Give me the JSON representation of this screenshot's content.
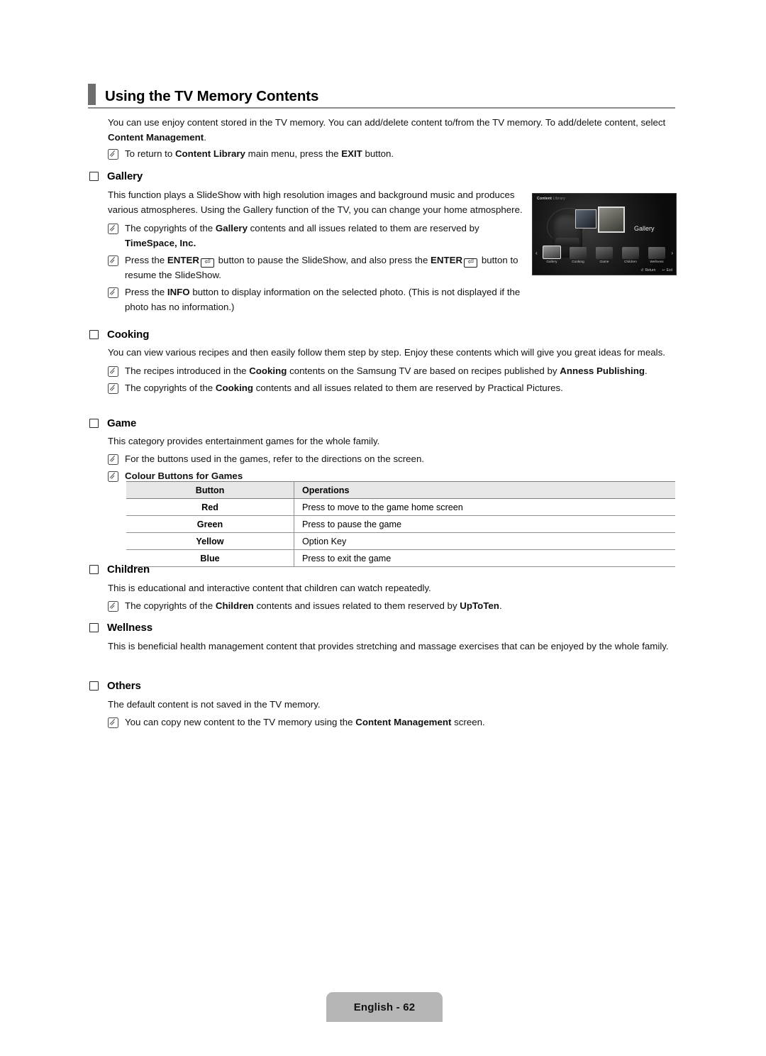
{
  "page": {
    "title": "Using the TV Memory Contents",
    "footer_label": "English - 62"
  },
  "intro": {
    "line1_a": "You can use enjoy content stored in the TV memory. You can add/delete content to/from the TV memory. To add/delete content, select ",
    "line1_b": "Content Management",
    "line1_c": ".",
    "note_a": "To return to ",
    "note_b": "Content Library",
    "note_c": " main menu, press the ",
    "note_d": "EXIT",
    "note_e": " button."
  },
  "gallery": {
    "heading": "Gallery",
    "body": "This function plays a SlideShow with high resolution images and background music and produces various atmospheres. Using the Gallery function of the TV, you can change your home atmosphere.",
    "note1_a": "The copyrights of the ",
    "note1_b": "Gallery",
    "note1_c": " contents and all issues related to them are reserved by ",
    "note1_d": "TimeSpace, Inc.",
    "note2_a": "Press the ",
    "note2_b": "ENTER",
    "note2_c": " button to pause the SlideShow, and also press the ",
    "note2_d": "ENTER",
    "note2_e": " button to resume the SlideShow.",
    "note3_a": "Press the ",
    "note3_b": "INFO",
    "note3_c": " button to display information on the selected photo. (This is not displayed if the photo has no information.)"
  },
  "tv_screenshot": {
    "top_left_label_1": "Content",
    "top_left_label_2": "Library",
    "selected_title": "Gallery",
    "items": [
      {
        "label": "Gallery"
      },
      {
        "label": "Cooking"
      },
      {
        "label": "Game"
      },
      {
        "label": "Children"
      },
      {
        "label": "Wellness"
      }
    ],
    "prev_arrow": "‹",
    "next_arrow": "›",
    "return_label": "Return",
    "exit_label": "Exit",
    "return_icon": "↺",
    "exit_icon": "↩"
  },
  "cooking": {
    "heading": "Cooking",
    "body": "You can view various recipes and then easily follow them step by step. Enjoy these contents which will give you great ideas for meals.",
    "note1_a": "The recipes introduced in the ",
    "note1_b": "Cooking",
    "note1_c": " contents on the Samsung TV are based on recipes published by ",
    "note1_d": "Anness Publishing",
    "note1_e": ".",
    "note2_a": "The copyrights of the ",
    "note2_b": "Cooking",
    "note2_c": " contents and all issues related to them are reserved by Practical Pictures."
  },
  "game": {
    "heading": "Game",
    "body": "This category provides entertainment games for the whole family.",
    "note1": "For the buttons used in the games, refer to the directions on the screen.",
    "note2": "Colour Buttons for Games",
    "table": {
      "columns": [
        "Button",
        "Operations"
      ],
      "rows": [
        [
          "Red",
          "Press to move to the game home screen"
        ],
        [
          "Green",
          "Press to pause the game"
        ],
        [
          "Yellow",
          "Option Key"
        ],
        [
          "Blue",
          "Press to exit the game"
        ]
      ]
    }
  },
  "children": {
    "heading": "Children",
    "body": "This is educational and interactive content that children can watch repeatedly.",
    "note1_a": "The copyrights of the ",
    "note1_b": "Children",
    "note1_c": " contents and issues related to them reserved by ",
    "note1_d": "UpToTen",
    "note1_e": "."
  },
  "wellness": {
    "heading": "Wellness",
    "body": "This is beneficial health management content that provides stretching and massage exercises that can be enjoyed by the whole family."
  },
  "others": {
    "heading": "Others",
    "body": "The default content is not saved in the TV memory.",
    "note1_a": "You can copy new content to the TV memory using the ",
    "note1_b": "Content Management",
    "note1_c": " screen."
  },
  "colors": {
    "title_bar": "#6e6e6e",
    "table_header_bg": "#e6e6e6",
    "footer_badge_bg": "#b6b6b6"
  }
}
